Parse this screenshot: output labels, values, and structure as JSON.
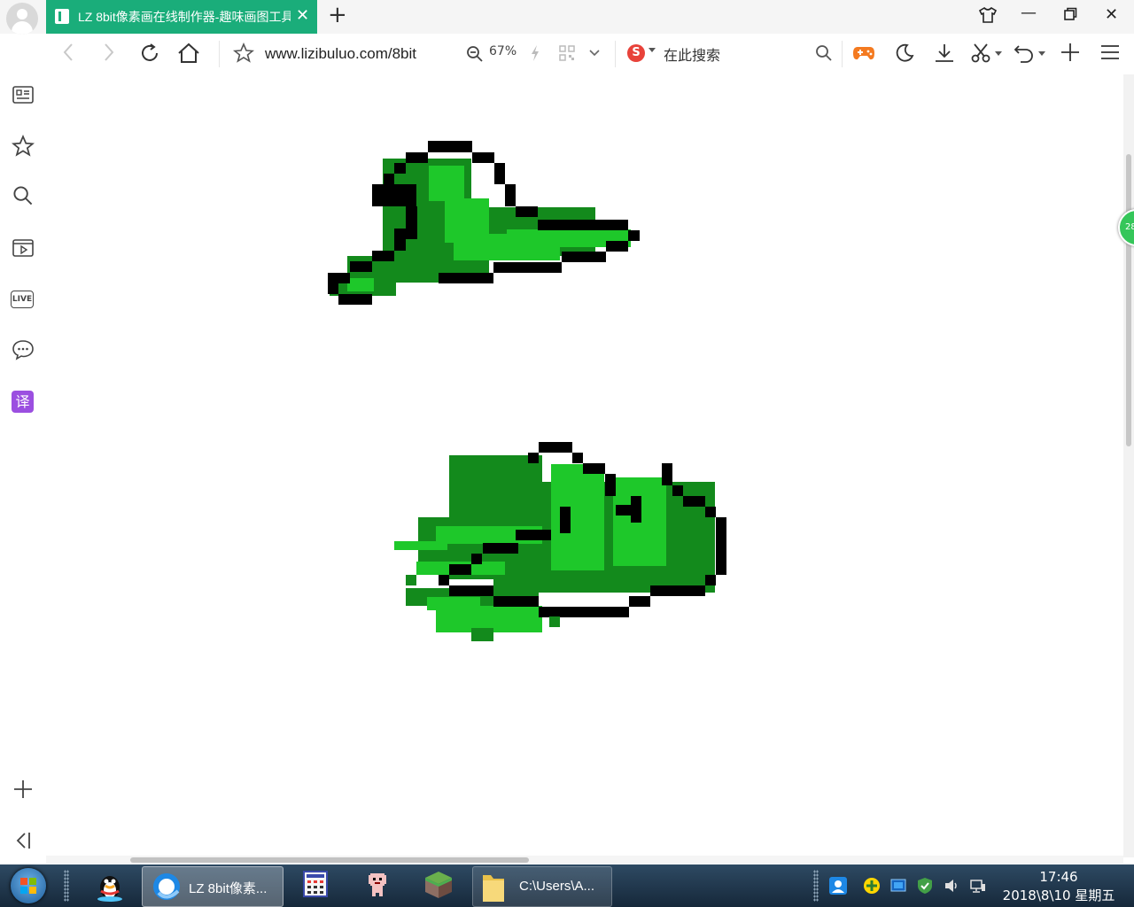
{
  "browser": {
    "tab_title": "LZ 8bit像素画在线制作器-趣味画图工具",
    "address": "www.lizibuluo.com/8bit",
    "zoom": "67%",
    "search_placeholder": "在此搜索",
    "floating_badge": "28"
  },
  "sidebar": {
    "live_label": "LIVE",
    "translate_label": "译"
  },
  "colors": {
    "tab_active": "#1aad7a",
    "pixel_outline": "#000000",
    "pixel_dark_green": "#138a1c",
    "pixel_light_green": "#1ec82a"
  },
  "taskbar": {
    "browser_task_label": "LZ 8bit像素...",
    "explorer_task_label": "C:\\Users\\A...",
    "time": "17:46",
    "date": "2018\\8\\10 星期五"
  }
}
